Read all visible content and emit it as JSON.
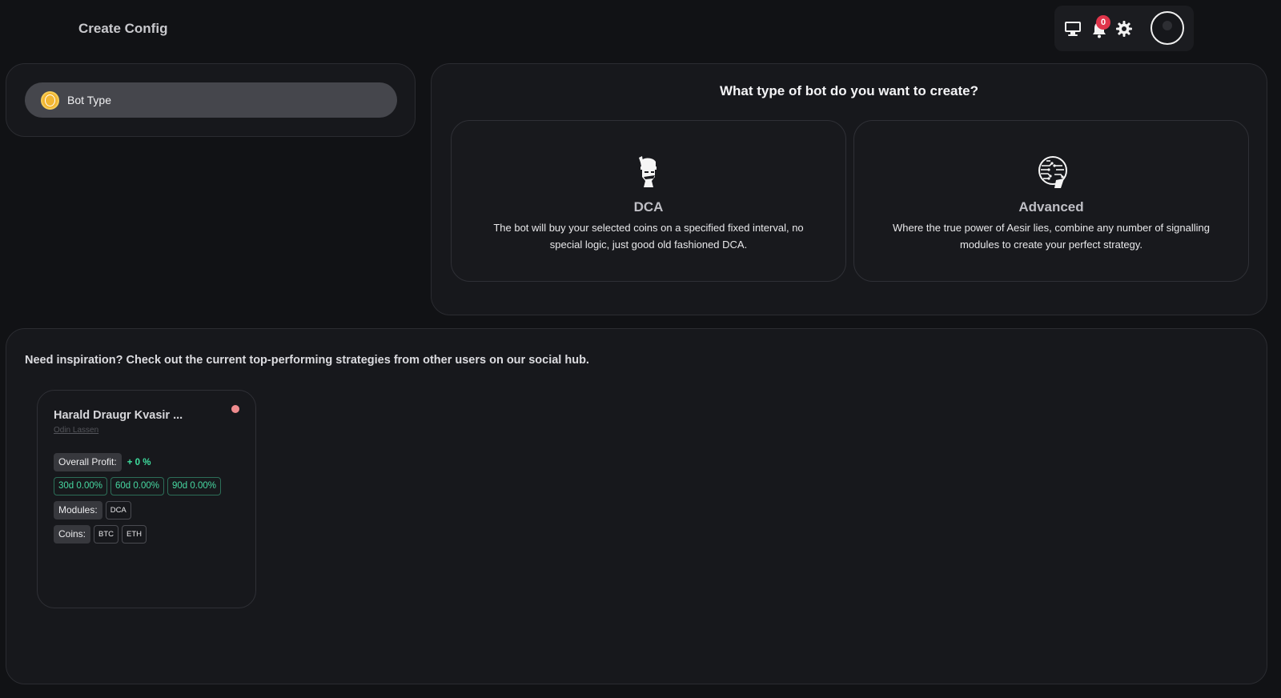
{
  "header": {
    "title": "Create Config",
    "notification_count": "0"
  },
  "steps": [
    {
      "label": "Bot Type",
      "icon": "coin-icon"
    }
  ],
  "bot_type": {
    "heading": "What type of bot do you want to create?",
    "options": [
      {
        "name": "DCA",
        "description": "The bot will buy your selected coins on a specified fixed interval, no special logic, just good old fashioned DCA.",
        "icon": "viking-icon"
      },
      {
        "name": "Advanced",
        "description": "Where the true power of Aesir lies, combine any number of signalling modules to create your perfect strategy.",
        "icon": "circuit-head-icon"
      }
    ]
  },
  "social_hub": {
    "heading": "Need inspiration? Check out the current top-performing strategies from other users on our social hub.",
    "strategies": [
      {
        "name": "Harald Draugr Kvasir ...",
        "author": "Odin Lassen",
        "status_color": "#ef8b8e",
        "overall_profit_label": "Overall Profit:",
        "overall_profit_value": "+ 0 %",
        "periods": [
          "30d 0.00%",
          "60d 0.00%",
          "90d 0.00%"
        ],
        "modules_label": "Modules:",
        "modules": [
          "DCA"
        ],
        "coins_label": "Coins:",
        "coins": [
          "BTC",
          "ETH"
        ]
      }
    ]
  },
  "colors": {
    "background": "#111215",
    "panel": "#17181c",
    "accent_green": "#47d9a2",
    "badge_red": "#e0354b",
    "coin_gold": "#f2b632"
  }
}
